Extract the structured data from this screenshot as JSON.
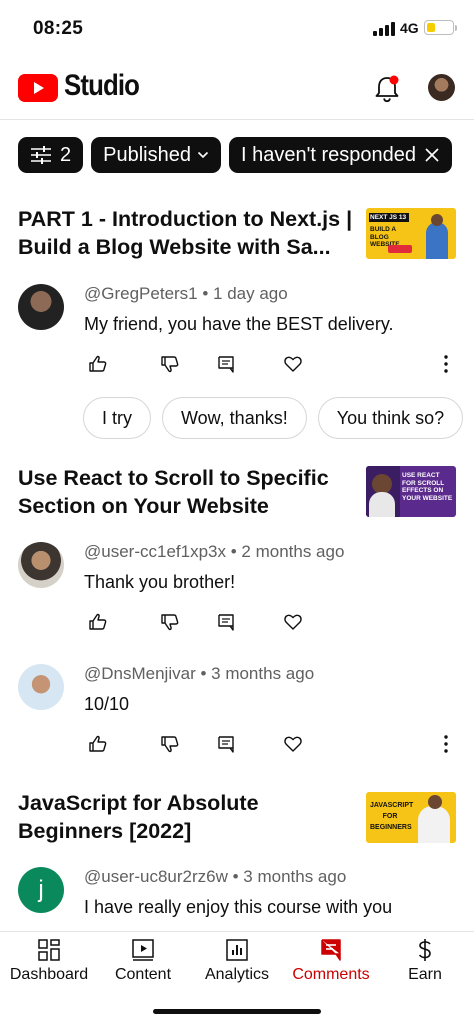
{
  "status_bar": {
    "time": "08:25",
    "network": "4G"
  },
  "header": {
    "brand": "Studio"
  },
  "filters": {
    "count": "2",
    "published_label": "Published",
    "response_label": "I haven't responded"
  },
  "videos": [
    {
      "title": "PART 1 - Introduction to Next.js | Build a Blog Website with Sa...",
      "thumb_text": "NEXT JS 13 · BUILD A BLOG WEBSITE · SANITY",
      "comments": [
        {
          "author": "@GregPeters1",
          "time": "1 day ago",
          "text": "My friend, you have the BEST delivery."
        }
      ],
      "suggested_replies": [
        "I try",
        "Wow, thanks!",
        "You think so?"
      ]
    },
    {
      "title": "Use React to Scroll to Specific Section on Your Website",
      "thumb_text": "USE REACT FOR SCROLL EFFECTS ON YOUR WEBSITE",
      "comments": [
        {
          "author": "@user-cc1ef1xp3x",
          "time": "2 months ago",
          "text": "Thank you brother!"
        },
        {
          "author": "@DnsMenjivar",
          "time": "3 months ago",
          "text": "10/10"
        }
      ]
    },
    {
      "title": "JavaScript for Absolute Beginners [2022]",
      "thumb_text": "JAVASCRIPT FOR BEGINNERS",
      "comments": [
        {
          "author": "@user-uc8ur2rz6w",
          "time": "3 months ago",
          "text": "I have really enjoy this course with you",
          "avatar_letter": "j"
        }
      ]
    }
  ],
  "nav": {
    "items": [
      {
        "label": "Dashboard",
        "icon": "dashboard-icon"
      },
      {
        "label": "Content",
        "icon": "content-icon"
      },
      {
        "label": "Analytics",
        "icon": "analytics-icon"
      },
      {
        "label": "Comments",
        "icon": "comments-icon"
      },
      {
        "label": "Earn",
        "icon": "earn-icon"
      }
    ],
    "active": "Comments"
  },
  "colors": {
    "accent": "#cc0000",
    "brand_red": "#ff0000",
    "battery": "#f6cd00",
    "avatar_green": "#0a8a5c"
  }
}
